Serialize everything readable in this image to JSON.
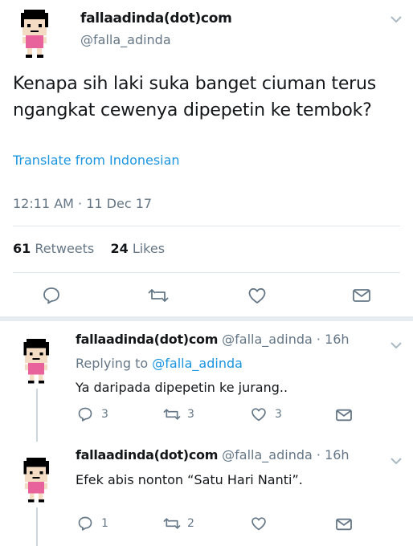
{
  "main_tweet": {
    "display_name": "fallaadinda(dot)com",
    "handle": "@falla_adinda",
    "text": "Kenapa sih laki suka banget ciuman terus ngangkat cewenya dipepetin ke tembok?",
    "translate_label": "Translate from Indonesian",
    "timestamp": "12:11 AM · 11 Dec 17",
    "retweets_count": "61",
    "retweets_label": "Retweets",
    "likes_count": "24",
    "likes_label": "Likes"
  },
  "replies": [
    {
      "display_name": "fallaadinda(dot)com",
      "handle_time": "@falla_adinda · 16h",
      "replying_prefix": "Replying to",
      "replying_to": "@falla_adinda",
      "text": "Ya daripada dipepetin ke jurang..",
      "reply_count": "3",
      "retweet_count": "3",
      "like_count": "3"
    },
    {
      "display_name": "fallaadinda(dot)com",
      "handle_time": "@falla_adinda · 16h",
      "text": "Efek abis nonton “Satu Hari Nanti”.",
      "reply_count": "1",
      "retweet_count": "2",
      "like_count": ""
    }
  ],
  "icons": {
    "reply": "reply-icon",
    "retweet": "retweet-icon",
    "like": "heart-icon",
    "dm": "envelope-icon",
    "more": "chevron-down-icon"
  },
  "colors": {
    "link": "#1b95e0",
    "muted": "#657786",
    "divider": "#e1e8ed",
    "avatar_dress": "#e8639c"
  }
}
